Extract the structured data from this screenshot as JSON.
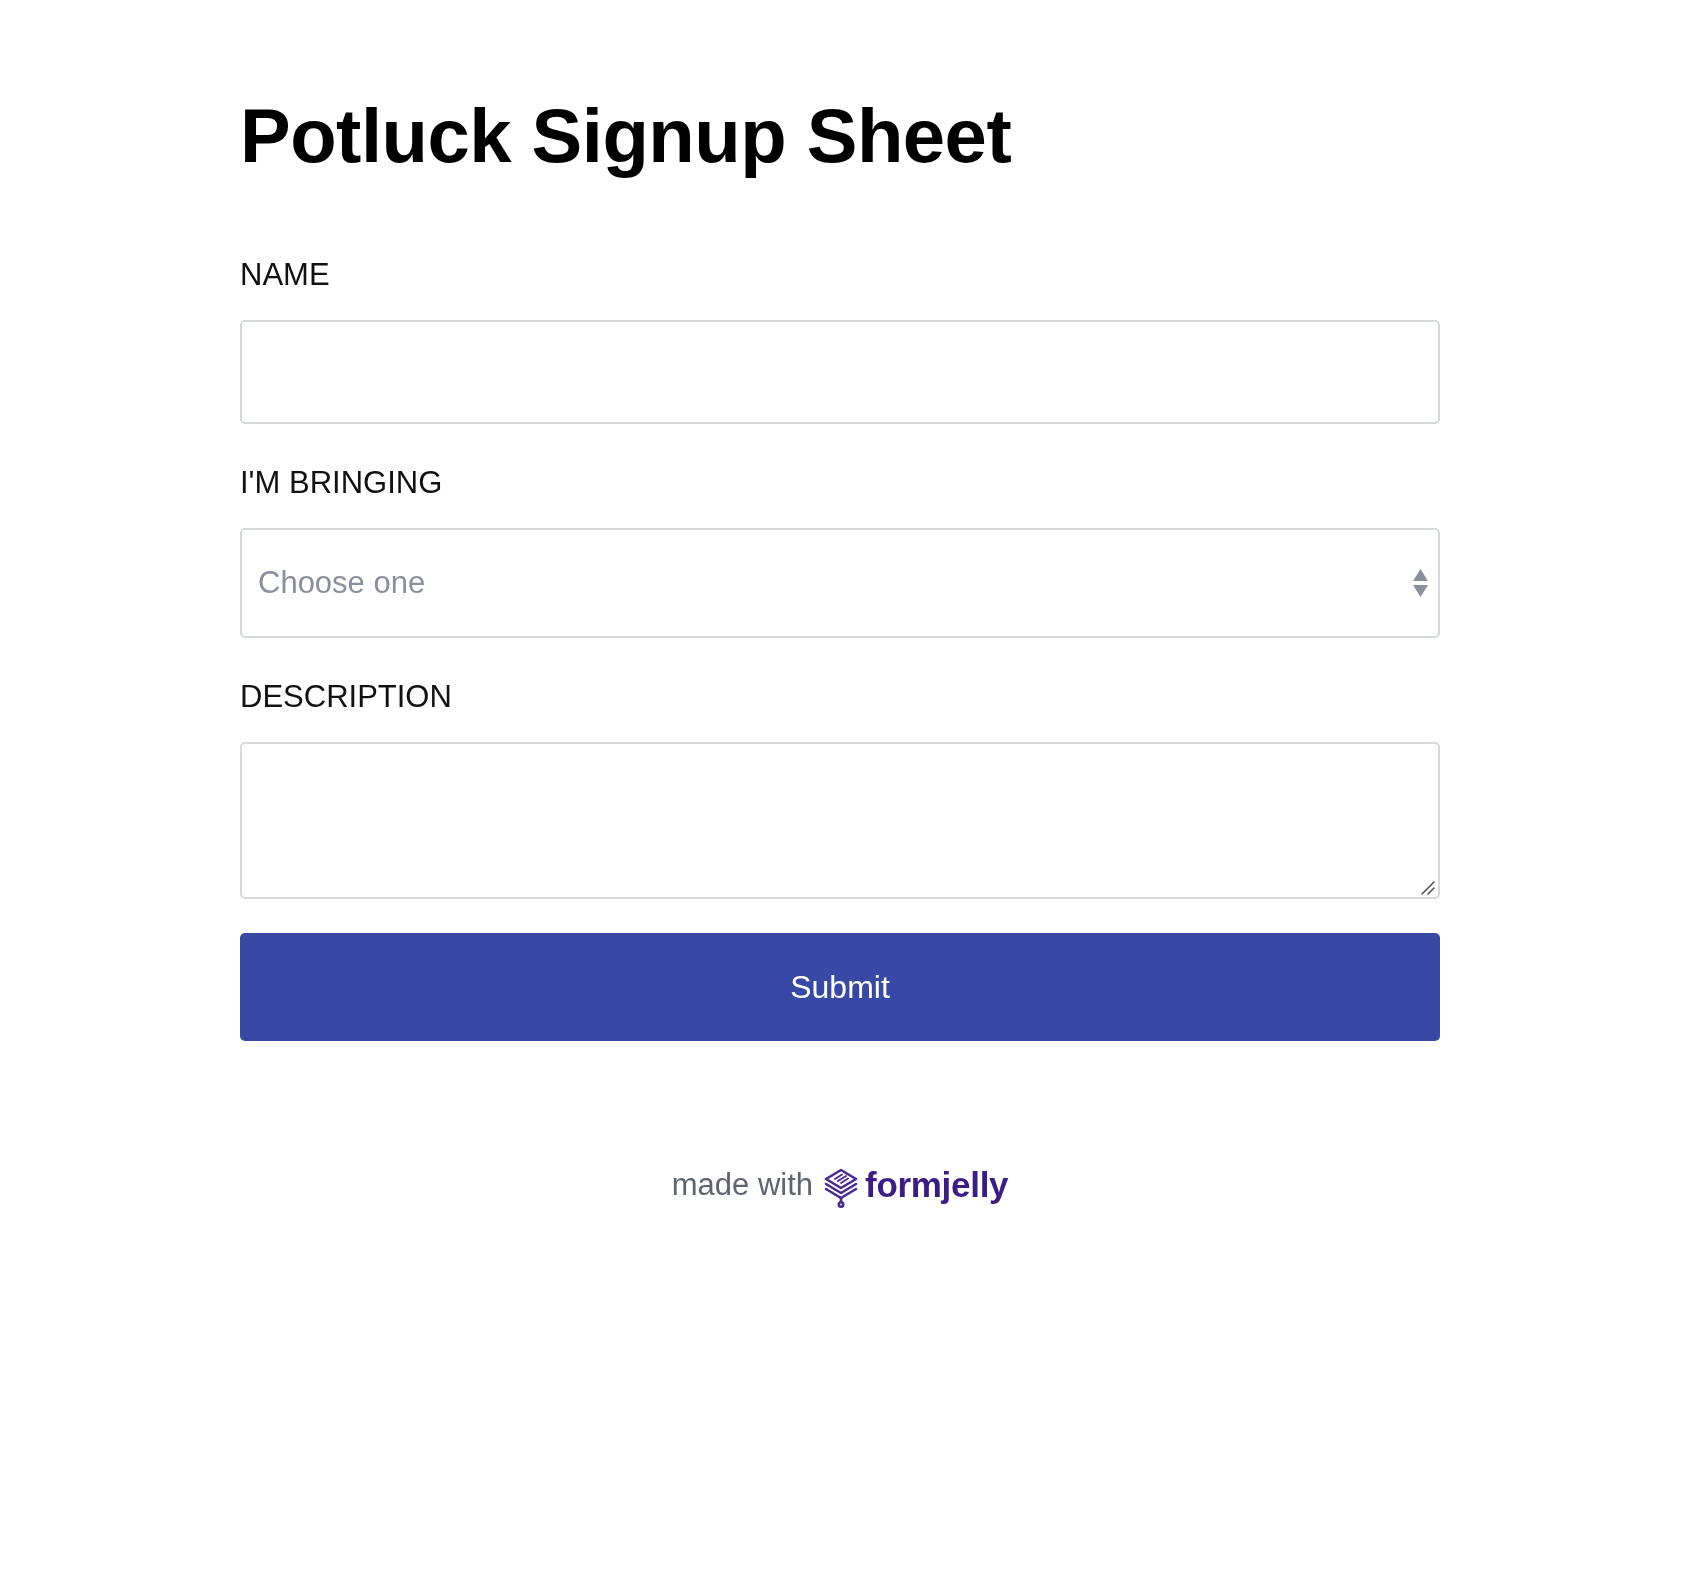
{
  "title": "Potluck Signup Sheet",
  "fields": [
    {
      "kind": "text",
      "label": "NAME"
    },
    {
      "kind": "select",
      "label": "I'M BRINGING",
      "placeholder": "Choose one"
    },
    {
      "kind": "textarea",
      "label": "DESCRIPTION"
    }
  ],
  "submit_button": {
    "label": "Submit"
  },
  "footer": {
    "text": "made with",
    "brand": "formjelly"
  }
}
